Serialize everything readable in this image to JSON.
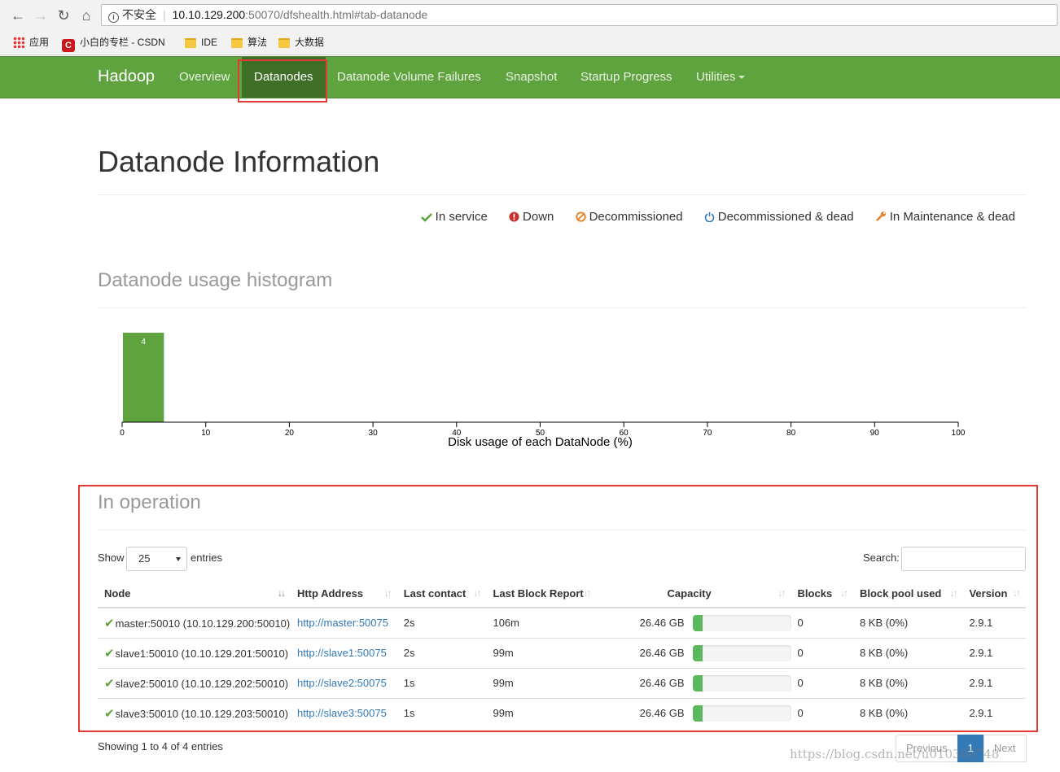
{
  "browser": {
    "security_label": "不安全",
    "url_host": "10.10.129.200",
    "url_rest": ":50070/dfshealth.html#tab-datanode",
    "bookmarks": [
      "应用",
      "小白的专栏 - CSDN",
      "IDE",
      "算法",
      "大数据"
    ]
  },
  "navbar": {
    "brand": "Hadoop",
    "items": [
      "Overview",
      "Datanodes",
      "Datanode Volume Failures",
      "Snapshot",
      "Startup Progress",
      "Utilities"
    ],
    "active": "Datanodes"
  },
  "page": {
    "title": "Datanode Information",
    "legend": [
      "In service",
      "Down",
      "Decommissioned",
      "Decommissioned & dead",
      "In Maintenance & dead"
    ]
  },
  "histogram": {
    "title": "Datanode usage histogram",
    "chart_data": {
      "type": "bar",
      "bins": [
        [
          0,
          5
        ]
      ],
      "values": [
        4
      ],
      "xlabel": "Disk usage of each DataNode (%)",
      "xlim": [
        0,
        100
      ],
      "xticks": [
        0,
        10,
        20,
        30,
        40,
        50,
        60,
        70,
        80,
        90,
        100
      ],
      "bar_color": "#5fa33e"
    }
  },
  "operation": {
    "title": "In operation",
    "show_label": "Show",
    "page_size": "25",
    "entries_label": "entries",
    "search_label": "Search:",
    "search_value": "",
    "columns": [
      "Node",
      "Http Address",
      "Last contact",
      "Last Block Report",
      "Capacity",
      "Blocks",
      "Block pool used",
      "Version"
    ],
    "rows": [
      {
        "node": "master:50010 (10.10.129.200:50010)",
        "http": "http://master:50075",
        "last_contact": "2s",
        "last_block_report": "106m",
        "capacity": "26.46 GB",
        "capacity_used_fraction": 0.1,
        "blocks": "0",
        "block_pool_used": "8 KB (0%)",
        "version": "2.9.1"
      },
      {
        "node": "slave1:50010 (10.10.129.201:50010)",
        "http": "http://slave1:50075",
        "last_contact": "2s",
        "last_block_report": "99m",
        "capacity": "26.46 GB",
        "capacity_used_fraction": 0.1,
        "blocks": "0",
        "block_pool_used": "8 KB (0%)",
        "version": "2.9.1"
      },
      {
        "node": "slave2:50010 (10.10.129.202:50010)",
        "http": "http://slave2:50075",
        "last_contact": "1s",
        "last_block_report": "99m",
        "capacity": "26.46 GB",
        "capacity_used_fraction": 0.1,
        "blocks": "0",
        "block_pool_used": "8 KB (0%)",
        "version": "2.9.1"
      },
      {
        "node": "slave3:50010 (10.10.129.203:50010)",
        "http": "http://slave3:50075",
        "last_contact": "1s",
        "last_block_report": "99m",
        "capacity": "26.46 GB",
        "capacity_used_fraction": 0.1,
        "blocks": "0",
        "block_pool_used": "8 KB (0%)",
        "version": "2.9.1"
      }
    ],
    "info": "Showing 1 to 4 of 4 entries",
    "pagination": {
      "previous": "Previous",
      "current": "1",
      "next": "Next"
    }
  },
  "watermark": "https://blog.csdn.net/u010366748",
  "colors": {
    "navbar": "#5fa33e",
    "navbar_active": "#3f6f27",
    "link": "#337ab7",
    "highlight_box": "#e53935"
  }
}
